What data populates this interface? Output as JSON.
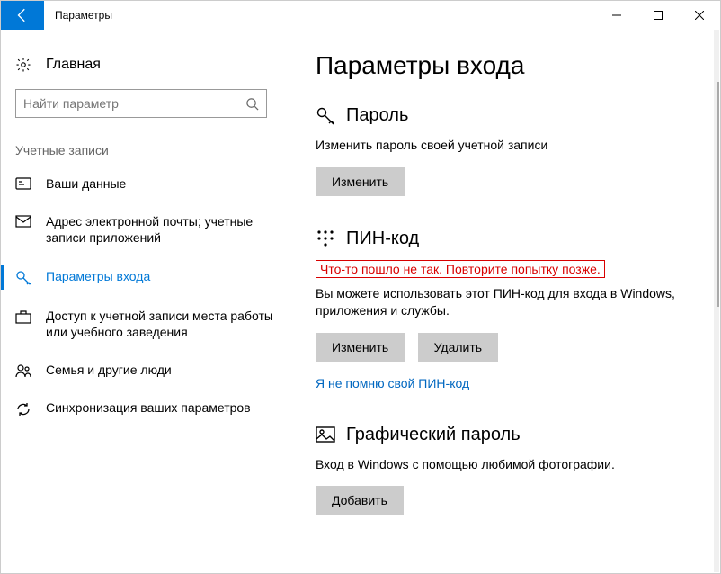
{
  "window": {
    "title": "Параметры"
  },
  "sidebar": {
    "home_label": "Главная",
    "search_placeholder": "Найти параметр",
    "section_label": "Учетные записи",
    "items": [
      {
        "label": "Ваши данные"
      },
      {
        "label": "Адрес электронной почты; учетные записи приложений"
      },
      {
        "label": "Параметры входа"
      },
      {
        "label": "Доступ к учетной записи места работы или учебного заведения"
      },
      {
        "label": "Семья и другие люди"
      },
      {
        "label": "Синхронизация ваших параметров"
      }
    ]
  },
  "main": {
    "title": "Параметры входа",
    "password": {
      "heading": "Пароль",
      "desc": "Изменить пароль своей учетной записи",
      "change_btn": "Изменить"
    },
    "pin": {
      "heading": "ПИН-код",
      "error": "Что-то пошло не так. Повторите попытку позже.",
      "desc": "Вы можете использовать этот ПИН-код для входа в Windows, приложения и службы.",
      "change_btn": "Изменить",
      "delete_btn": "Удалить",
      "forgot_link": "Я не помню свой ПИН-код"
    },
    "picture": {
      "heading": "Графический пароль",
      "desc": "Вход в Windows с помощью любимой фотографии.",
      "add_btn": "Добавить"
    }
  }
}
